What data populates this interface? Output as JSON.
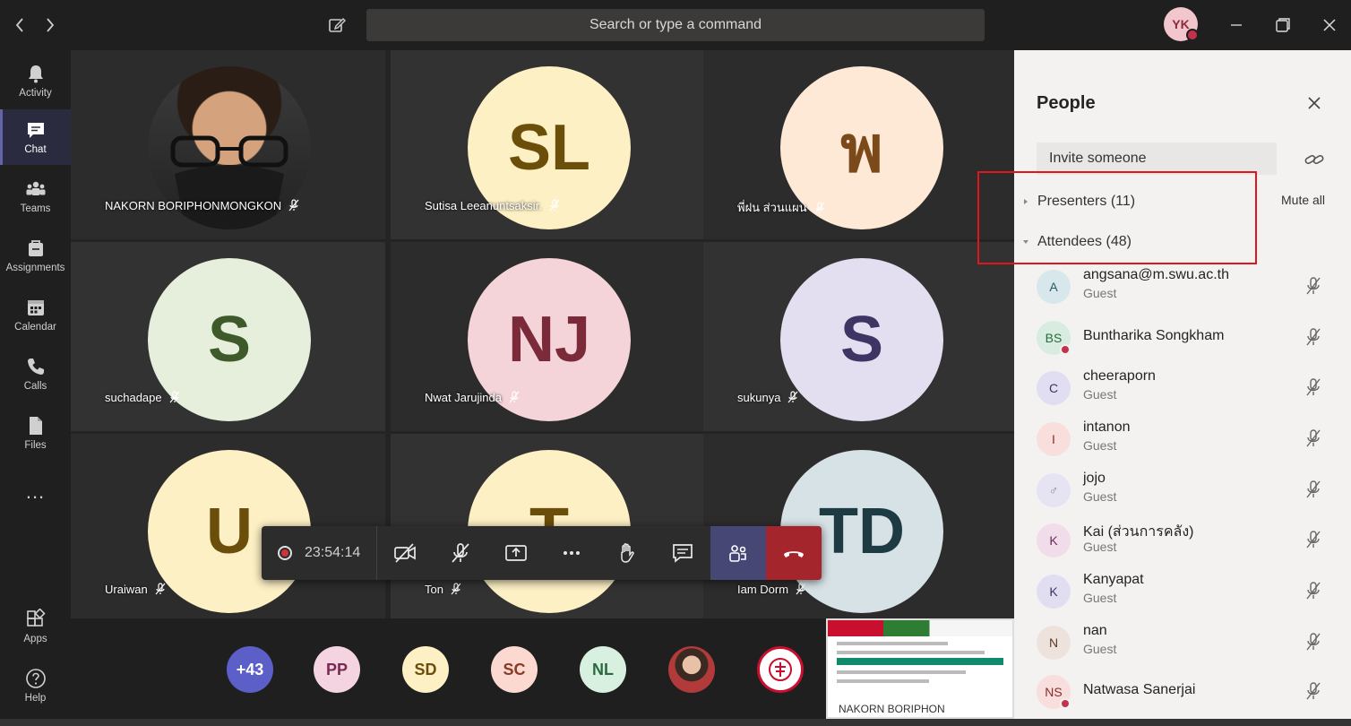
{
  "titlebar": {
    "search_placeholder": "Search or type a command",
    "user_initials": "YK"
  },
  "rail": [
    {
      "label": "Activity",
      "icon": "bell-icon"
    },
    {
      "label": "Chat",
      "icon": "chat-icon",
      "active": true
    },
    {
      "label": "Teams",
      "icon": "teams-icon"
    },
    {
      "label": "Assignments",
      "icon": "assignments-icon"
    },
    {
      "label": "Calendar",
      "icon": "calendar-icon"
    },
    {
      "label": "Calls",
      "icon": "phone-icon"
    },
    {
      "label": "Files",
      "icon": "file-icon"
    },
    {
      "label": "...",
      "icon": "more-icon"
    },
    {
      "label": "Apps",
      "icon": "apps-icon"
    },
    {
      "label": "Help",
      "icon": "help-icon"
    }
  ],
  "tiles": [
    {
      "name": "NAKORN BORIPHONMONGKON",
      "initials": "",
      "bg": "",
      "fg": "",
      "photo": true
    },
    {
      "name": "Sutisa Leeanuntsaksir.",
      "initials": "SL",
      "bg": "#fdf0c4",
      "fg": "#6b4e0a"
    },
    {
      "name": "พี่ฝน ส่วนแผน",
      "initials": "พ",
      "bg": "#fde9d6",
      "fg": "#7a4a1a"
    },
    {
      "name": "suchadape",
      "initials": "S",
      "bg": "#e5efdc",
      "fg": "#3f5a2a"
    },
    {
      "name": "Nwat Jarujinda",
      "initials": "NJ",
      "bg": "#f4d4d8",
      "fg": "#7a2a38"
    },
    {
      "name": "sukunya",
      "initials": "S",
      "bg": "#e3def0",
      "fg": "#3e3565"
    },
    {
      "name": "Uraiwan",
      "initials": "U",
      "bg": "#fdf0c4",
      "fg": "#6b4e0a"
    },
    {
      "name": "Ton",
      "initials": "T",
      "bg": "#fdf0c4",
      "fg": "#6b4e0a"
    },
    {
      "name": "Iam Dorm",
      "initials": "TD",
      "bg": "#d6e2e6",
      "fg": "#1e3b44"
    }
  ],
  "callbar": {
    "timer": "23:54:14"
  },
  "strip": [
    {
      "label": "+43",
      "bg": "#5b5fc7",
      "fg": "#ffffff"
    },
    {
      "label": "PP",
      "bg": "#f4d4e0",
      "fg": "#7a2a50"
    },
    {
      "label": "SD",
      "bg": "#fdf0c4",
      "fg": "#6b4e0a"
    },
    {
      "label": "SC",
      "bg": "#fbd9d0",
      "fg": "#8a3a26"
    },
    {
      "label": "NL",
      "bg": "#d8f0e0",
      "fg": "#2a6a40"
    },
    {
      "label": "",
      "bg": "#caa08a",
      "fg": "#ffffff"
    },
    {
      "label": "",
      "bg": "#ffffff",
      "fg": "#c8102e"
    }
  ],
  "share": {
    "label": "NAKORN BORIPHON"
  },
  "people": {
    "title": "People",
    "invite_placeholder": "Invite someone",
    "presenters_label": "Presenters (11)",
    "attendees_label": "Attendees (48)",
    "mute_all": "Mute all",
    "list": [
      {
        "initials": "A",
        "name": "angsana@m.swu.ac.th",
        "role": "Guest",
        "bg": "#d7e7ec",
        "fg": "#2a5a6a",
        "dot": false
      },
      {
        "initials": "BS",
        "name": "Buntharika Songkham",
        "role": "",
        "bg": "#d8ecdf",
        "fg": "#2a6a40",
        "dot": true
      },
      {
        "initials": "C",
        "name": "cheeraporn",
        "role": "Guest",
        "bg": "#e1def2",
        "fg": "#3e3565",
        "dot": false
      },
      {
        "initials": "I",
        "name": "intanon",
        "role": "Guest",
        "bg": "#f9dede",
        "fg": "#8a2a2a",
        "dot": false
      },
      {
        "initials": "♂",
        "name": "jojo",
        "role": "Guest",
        "bg": "#e6e3f2",
        "fg": "#8884a8",
        "dot": false
      },
      {
        "initials": "K",
        "name": "Kai (ส่วนการคลัง)",
        "role": "Guest",
        "bg": "#f1dcea",
        "fg": "#6a2a5a",
        "dot": false
      },
      {
        "initials": "K",
        "name": "Kanyapat",
        "role": "Guest",
        "bg": "#e1def2",
        "fg": "#3e3565",
        "dot": false
      },
      {
        "initials": "N",
        "name": "nan",
        "role": "Guest",
        "bg": "#ede3dc",
        "fg": "#5a3a2a",
        "dot": false
      },
      {
        "initials": "NS",
        "name": "Natwasa Sanerjai",
        "role": "",
        "bg": "#f9dede",
        "fg": "#8a2a2a",
        "dot": true
      }
    ]
  }
}
